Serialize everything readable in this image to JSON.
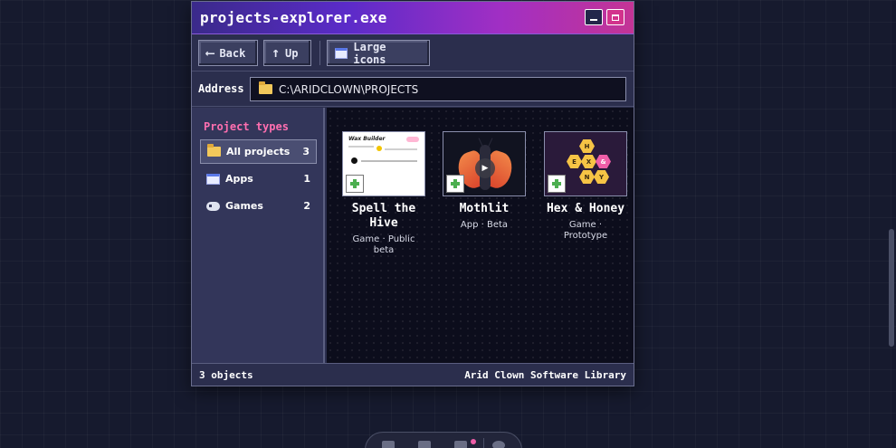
{
  "window": {
    "title": "projects-explorer.exe"
  },
  "toolbar": {
    "back_label": "Back",
    "up_label": "Up",
    "view_label": "Large icons"
  },
  "address": {
    "label": "Address",
    "value": "C:\\ARIDCLOWN\\PROJECTS"
  },
  "sidebar": {
    "title": "Project types",
    "items": [
      {
        "label": "All projects",
        "count": "3",
        "icon": "folder-icon",
        "active": true
      },
      {
        "label": "Apps",
        "count": "1",
        "icon": "window-icon",
        "active": false
      },
      {
        "label": "Games",
        "count": "2",
        "icon": "gamepad-icon",
        "active": false
      }
    ]
  },
  "projects": [
    {
      "title": "Spell the Hive",
      "subtitle": "Game · Public beta",
      "thumbnail": {
        "heading": "Wax Builder"
      }
    },
    {
      "title": "Mothlit",
      "subtitle": "App · Beta"
    },
    {
      "title": "Hex & Honey",
      "subtitle": "Game · Prototype",
      "thumbnail": {
        "letters": [
          "H",
          "E",
          "X",
          "&",
          "N",
          "Y"
        ]
      }
    }
  ],
  "status": {
    "count_text": "3 objects",
    "library_text": "Arid Clown Software Library"
  },
  "colors": {
    "accent_pink": "#ff6fb0",
    "title_gradient_start": "#3a2a8a",
    "title_gradient_end": "#c43495",
    "honey": "#f6c445"
  }
}
